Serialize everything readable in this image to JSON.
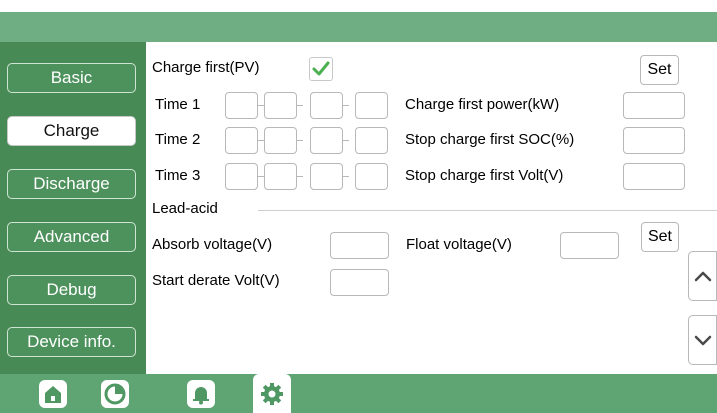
{
  "sidebar": {
    "items": [
      {
        "label": "Basic"
      },
      {
        "label": "Charge"
      },
      {
        "label": "Discharge"
      },
      {
        "label": "Advanced"
      },
      {
        "label": "Debug"
      },
      {
        "label": "Device info."
      }
    ],
    "active": "Charge"
  },
  "charge": {
    "charge_first_label": "Charge first(PV)",
    "charge_first_checked": true,
    "set_label": "Set",
    "time1_label": "Time 1",
    "time2_label": "Time 2",
    "time3_label": "Time 3",
    "charge_first_power_label": "Charge first power(kW)",
    "stop_soc_label": "Stop charge first SOC(%)",
    "stop_volt_label": "Stop charge first Volt(V)"
  },
  "lead_acid": {
    "section_label": "Lead-acid",
    "absorb_label": "Absorb voltage(V)",
    "float_label": "Float voltage(V)",
    "start_derate_label": "Start derate Volt(V)",
    "set_label": "Set"
  },
  "footer": {
    "icons": [
      "home-icon",
      "pie-chart-icon",
      "bell-icon",
      "gear-icon"
    ],
    "active": "gear-icon"
  },
  "colors": {
    "header": "#6fae82",
    "sidebar": "#478a55",
    "footer": "#5fa574",
    "check": "#4caf50"
  }
}
